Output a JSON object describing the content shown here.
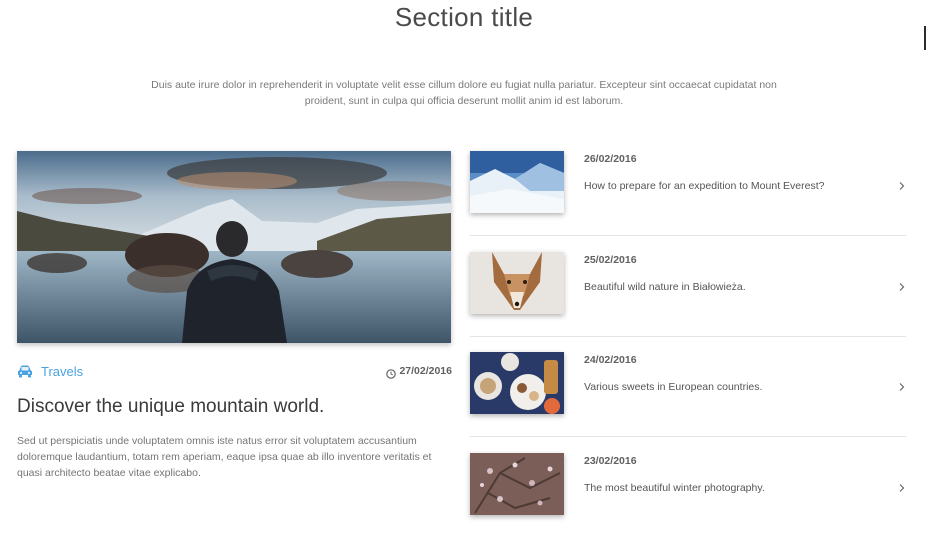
{
  "section": {
    "title": "Section title",
    "intro": "Duis aute irure dolor in reprehenderit in voluptate velit esse cillum dolore eu fugiat nulla pariatur. Excepteur sint occaecat cupidatat non proident, sunt in culpa qui officia deserunt mollit anim id est laborum."
  },
  "feature": {
    "image_icon": "photo-man-mountain-lake",
    "category_icon": "car-icon",
    "category": "Travels",
    "date_icon": "clock-icon",
    "date": "27/02/2016",
    "title": "Discover the unique mountain world.",
    "description": "Sed ut perspiciatis unde voluptatem omnis iste natus error sit voluptatem accusantium doloremque laudantium, totam rem aperiam, eaque ipsa quae ab illo inventore veritatis et quasi architecto beatae vitae explicabo."
  },
  "news": [
    {
      "date": "26/02/2016",
      "title": "How to prepare for an expedition to Mount Everest?",
      "thumb_icon": "photo-snowy-mountain"
    },
    {
      "date": "25/02/2016",
      "title": "Beautiful wild nature in Białowieża.",
      "thumb_icon": "photo-fox"
    },
    {
      "date": "24/02/2016",
      "title": "Various sweets in European countries.",
      "thumb_icon": "photo-sweets-table"
    },
    {
      "date": "23/02/2016",
      "title": "The most beautiful winter photography.",
      "thumb_icon": "photo-winter-branches"
    }
  ],
  "colors": {
    "accent": "#4aa3df",
    "text": "#616161",
    "heading": "#3a3a3a"
  }
}
